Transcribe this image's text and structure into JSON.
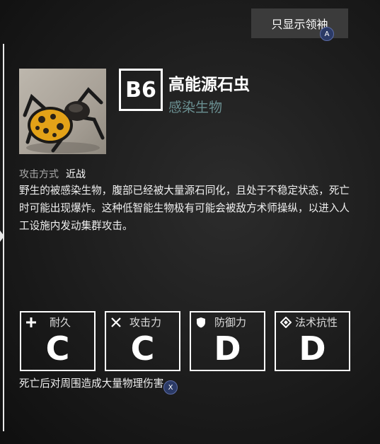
{
  "header": {
    "leader_only_label": "只显示领袖",
    "leader_only_key": "A"
  },
  "enemy": {
    "code": "B6",
    "name": "高能源石虫",
    "race": "感染生物",
    "attack_type_label": "攻击方式",
    "attack_type_value": "近战",
    "description": "野生的被感染生物，腹部已经被大量源石同化，且处于不稳定状态，死亡时可能出现爆炸。这种低智能生物极有可能会被敌方术师操纵，以进入人工设施内发动集群攻击。"
  },
  "stats": [
    {
      "label": "耐久",
      "grade": "C",
      "icon": "plus-icon"
    },
    {
      "label": "攻击力",
      "grade": "C",
      "icon": "crossed-swords-icon"
    },
    {
      "label": "防御力",
      "grade": "D",
      "icon": "shield-icon"
    },
    {
      "label": "法术抗性",
      "grade": "D",
      "icon": "diamond-icon"
    }
  ],
  "trait": {
    "text": "死亡后对周围造成大量物理伤害",
    "key": "X"
  },
  "colors": {
    "race_text": "#6a8f91",
    "key_badge": "#2b3a66",
    "button_bg": "#3b3b3b"
  }
}
